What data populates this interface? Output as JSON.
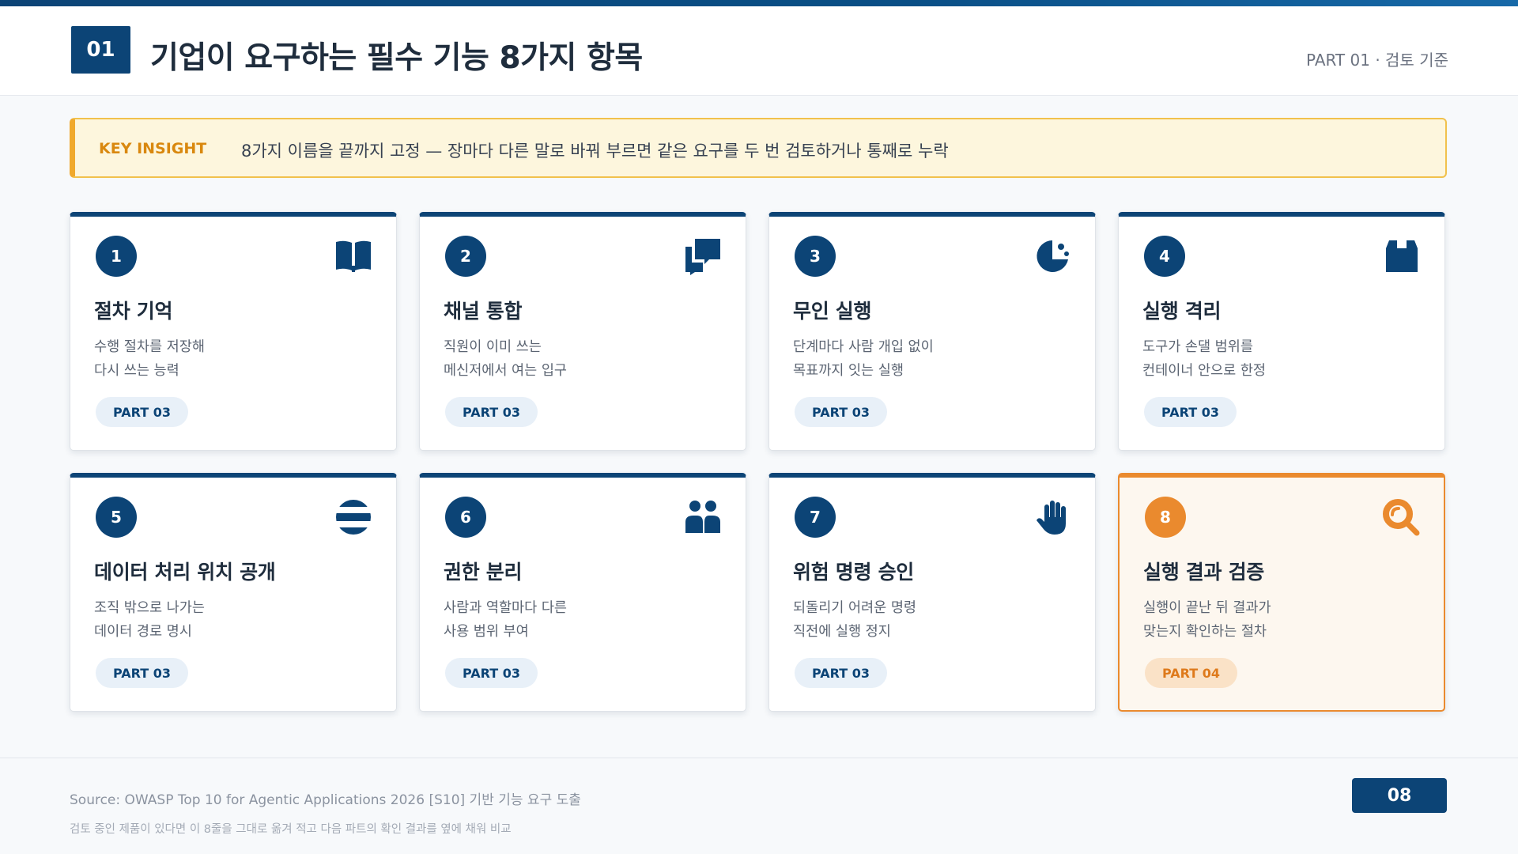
{
  "header": {
    "section_number": "01",
    "title": "기업이 요구하는 필수 기능 8가지 항목",
    "part_label": "PART 01 · 검토 기준"
  },
  "insight": {
    "label": "KEY INSIGHT",
    "text": "8가지 이름을 끝까지 고정 — 장마다 다른 말로 바꿔 부르면 같은 요구를 두 번 검토하거나 통째로 누락"
  },
  "cards": [
    {
      "number": "1",
      "icon": "book-icon",
      "title": "절차 기억",
      "desc": [
        "수행 절차를 저장해",
        "다시 쓰는 능력"
      ],
      "part": "PART 03"
    },
    {
      "number": "2",
      "icon": "chat-icon",
      "title": "채널 통합",
      "desc": [
        "직원이 이미 쓰는",
        "메신저에서 여는 입구"
      ],
      "part": "PART 03"
    },
    {
      "number": "3",
      "icon": "clock-icon",
      "title": "무인 실행",
      "desc": [
        "단계마다 사람 개입 없이",
        "목표까지 잇는 실행"
      ],
      "part": "PART 03"
    },
    {
      "number": "4",
      "icon": "box-icon",
      "title": "실행 격리",
      "desc": [
        "도구가 손댈 범위를",
        "컨테이너 안으로 한정"
      ],
      "part": "PART 03"
    },
    {
      "number": "5",
      "icon": "globe-icon",
      "title": "데이터 처리 위치 공개",
      "desc": [
        "조직 밖으로 나가는",
        "데이터 경로 명시"
      ],
      "part": "PART 03"
    },
    {
      "number": "6",
      "icon": "users-icon",
      "title": "권한 분리",
      "desc": [
        "사람과 역할마다 다른",
        "사용 범위 부여"
      ],
      "part": "PART 03"
    },
    {
      "number": "7",
      "icon": "hand-stop-icon",
      "title": "위험 명령 승인",
      "desc": [
        "되돌리기 어려운 명령",
        "직전에 실행 정지"
      ],
      "part": "PART 03"
    },
    {
      "number": "8",
      "icon": "search-icon",
      "title": "실행 결과 검증",
      "desc": [
        "실행이 끝난 뒤 결과가",
        "맞는지 확인하는 절차"
      ],
      "part": "PART 04",
      "highlight": true
    }
  ],
  "footer": {
    "source": "Source: OWASP Top 10 for Agentic Applications 2026 [S10] 기반 기능 요구 도출",
    "note": "검토 중인 제품이 있다면 이 8줄을 그대로 옮겨 적고 다음 파트의 확인 결과를 옆에 채워 비교",
    "page_number": "08"
  },
  "colors": {
    "primary": "#0c4476",
    "accent": "#ea8a2e",
    "insight_bg": "#fdf6dd",
    "insight_border": "#f1c14c"
  }
}
